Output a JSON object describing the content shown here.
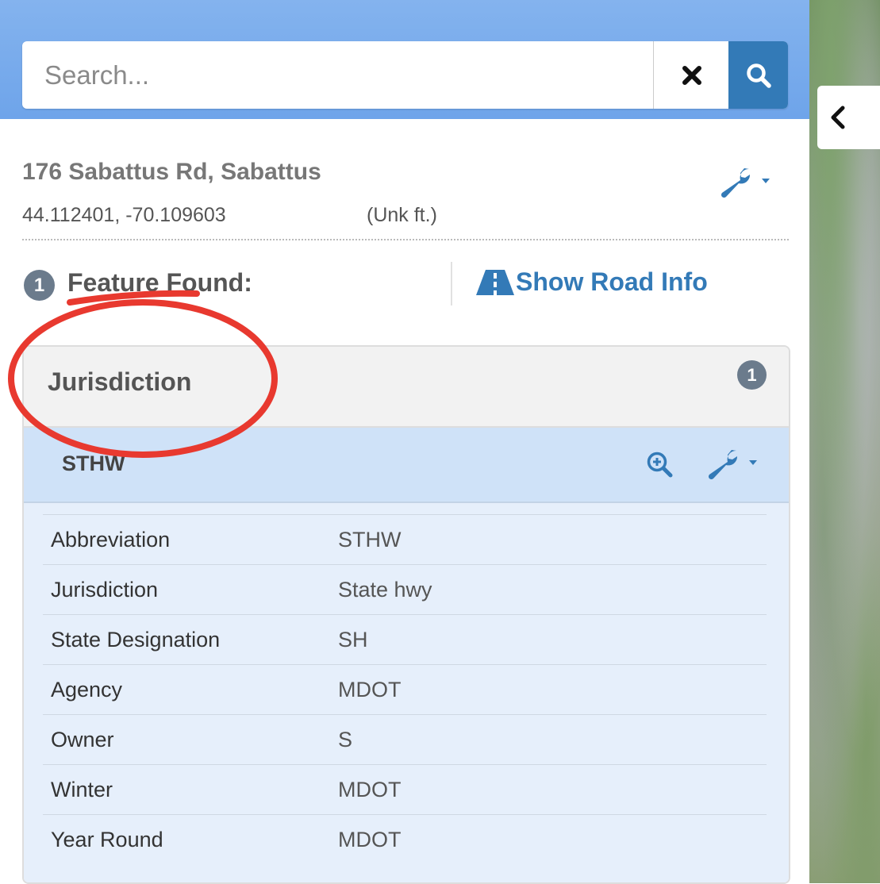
{
  "search": {
    "placeholder": "Search..."
  },
  "location": {
    "address": "176 Sabattus Rd, Sabattus",
    "coordinates": "44.112401, -70.109603",
    "elevation": "(Unk ft.)"
  },
  "results": {
    "count": "1",
    "label": "Feature Found:",
    "road_info_label": "Show Road Info"
  },
  "layer": {
    "title": "Jurisdiction",
    "count": "1",
    "feature": {
      "title": "STHW",
      "attributes": [
        {
          "key": "Abbreviation",
          "value": "STHW"
        },
        {
          "key": "Jurisdiction",
          "value": "State hwy"
        },
        {
          "key": "State Designation",
          "value": "SH"
        },
        {
          "key": "Agency",
          "value": "MDOT"
        },
        {
          "key": "Owner",
          "value": "S"
        },
        {
          "key": "Winter",
          "value": "MDOT"
        },
        {
          "key": "Year Round",
          "value": "MDOT"
        }
      ]
    }
  },
  "colors": {
    "header_blue": "#6ea4ea",
    "link_blue": "#337ab7",
    "badge_gray": "#6b7b8c",
    "annotation_red": "#e8392f"
  }
}
